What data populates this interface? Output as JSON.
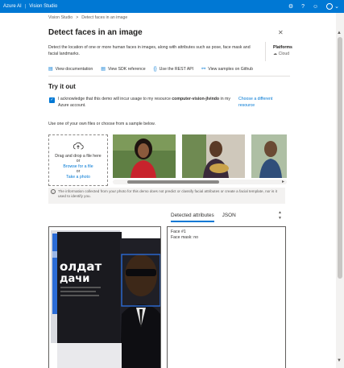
{
  "topbar": {
    "brand": "Azure AI",
    "separator": "|",
    "product": "Vision Studio",
    "icons": [
      "gear-icon",
      "help-icon",
      "smiley-icon",
      "account-icon"
    ]
  },
  "breadcrumb": {
    "root": "Vision Studio",
    "separator": ">",
    "current": "Detect faces in an image"
  },
  "page": {
    "title": "Detect faces in an image",
    "description": "Detect the location of one or more human faces in images, along with attributes such as pose, face mask and facial landmarks.",
    "platform_label": "Platforms",
    "platform_value": "Cloud"
  },
  "links": [
    {
      "label": "View documentation",
      "icon": "document-icon"
    },
    {
      "label": "View SDK reference",
      "icon": "document-icon"
    },
    {
      "label": "Use the REST API",
      "icon": "code-icon"
    },
    {
      "label": "View samples on Github",
      "icon": "github-icon"
    }
  ],
  "try_it": {
    "title": "Try it out",
    "ack_prefix": "I acknowledge that this demo will incur usage to my resource ",
    "ack_resource": "computer-vision-jlvindo",
    "ack_suffix": " in my Azure account.",
    "choose_resource": "Choose a different resource",
    "use_own": "Use one of your own files or choose from a sample below.",
    "upload_line1": "Drag and drop a file here",
    "upload_line2": "or",
    "upload_browse": "Browse for a file",
    "upload_line3": "or",
    "upload_photo": "Take a photo",
    "info": "The information collected from your photo for this demo does not predict or classify facial attributes or create a facial template, nor is it used to identify you."
  },
  "results": {
    "tabs": [
      "Detected attributes",
      "JSON"
    ],
    "active_tab": "Detected attributes",
    "lines": [
      "Face #1",
      "Face mask: no"
    ],
    "poster_text1": "олдат",
    "poster_text2": "дачи"
  },
  "colors": {
    "accent": "#0078d4",
    "detection_box": "#2b6cd6"
  }
}
